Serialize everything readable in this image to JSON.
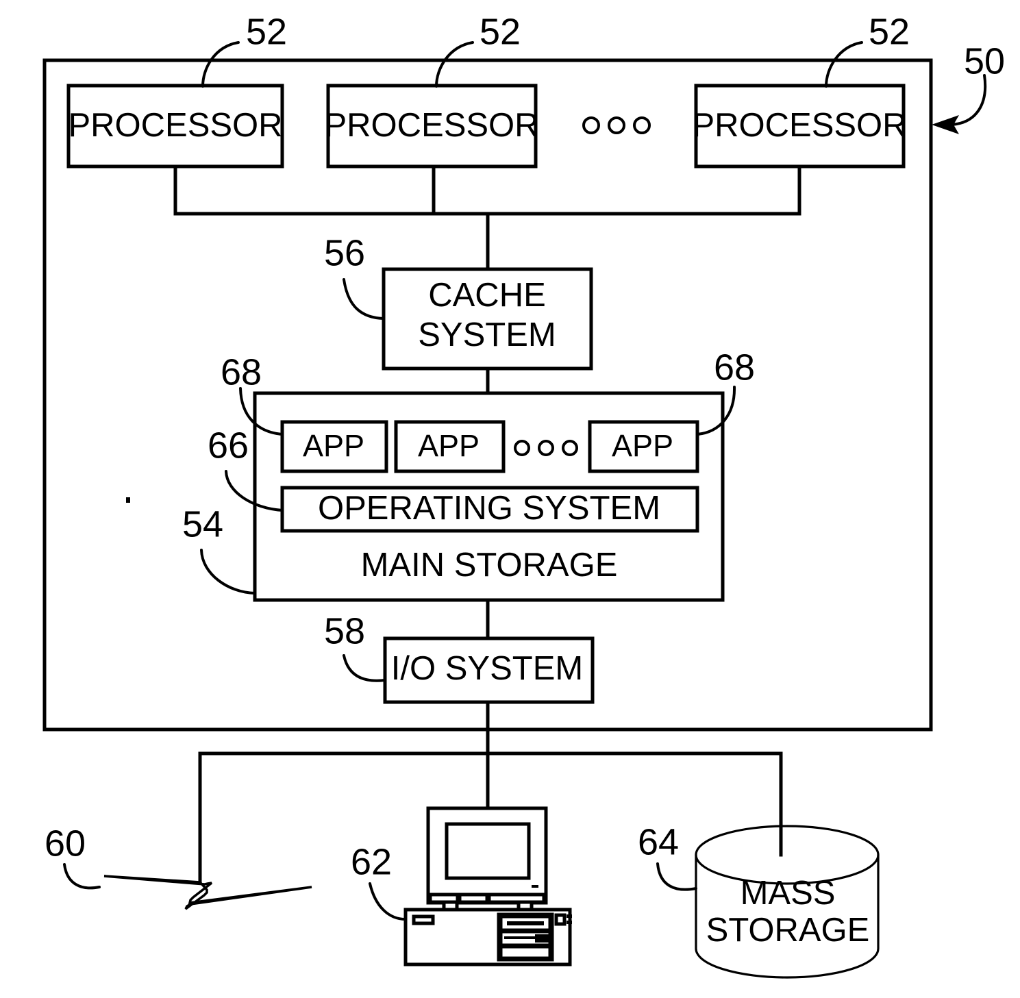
{
  "figure": {
    "title": "Computer system block diagram",
    "type": "patent-figure"
  },
  "blocks": {
    "processor_1": "PROCESSOR",
    "processor_2": "PROCESSOR",
    "processor_3": "PROCESSOR",
    "cache_line_1": "CACHE",
    "cache_line_2": "SYSTEM",
    "app_1": "APP",
    "app_2": "APP",
    "app_3": "APP",
    "operating_system": "OPERATING SYSTEM",
    "main_storage": "MAIN STORAGE",
    "io_system": "I/O SYSTEM",
    "mass_storage_line_1": "MASS",
    "mass_storage_line_2": "STORAGE"
  },
  "reference_numerals": {
    "system": "50",
    "processor_a": "52",
    "processor_b": "52",
    "processor_c": "52",
    "main_storage": "54",
    "cache_system": "56",
    "io_system": "58",
    "network": "60",
    "workstation": "62",
    "mass_storage": "64",
    "operating_system": "66",
    "app_left": "68",
    "app_right": "68"
  },
  "colors": {
    "ink": "#000000",
    "paper": "#ffffff"
  }
}
